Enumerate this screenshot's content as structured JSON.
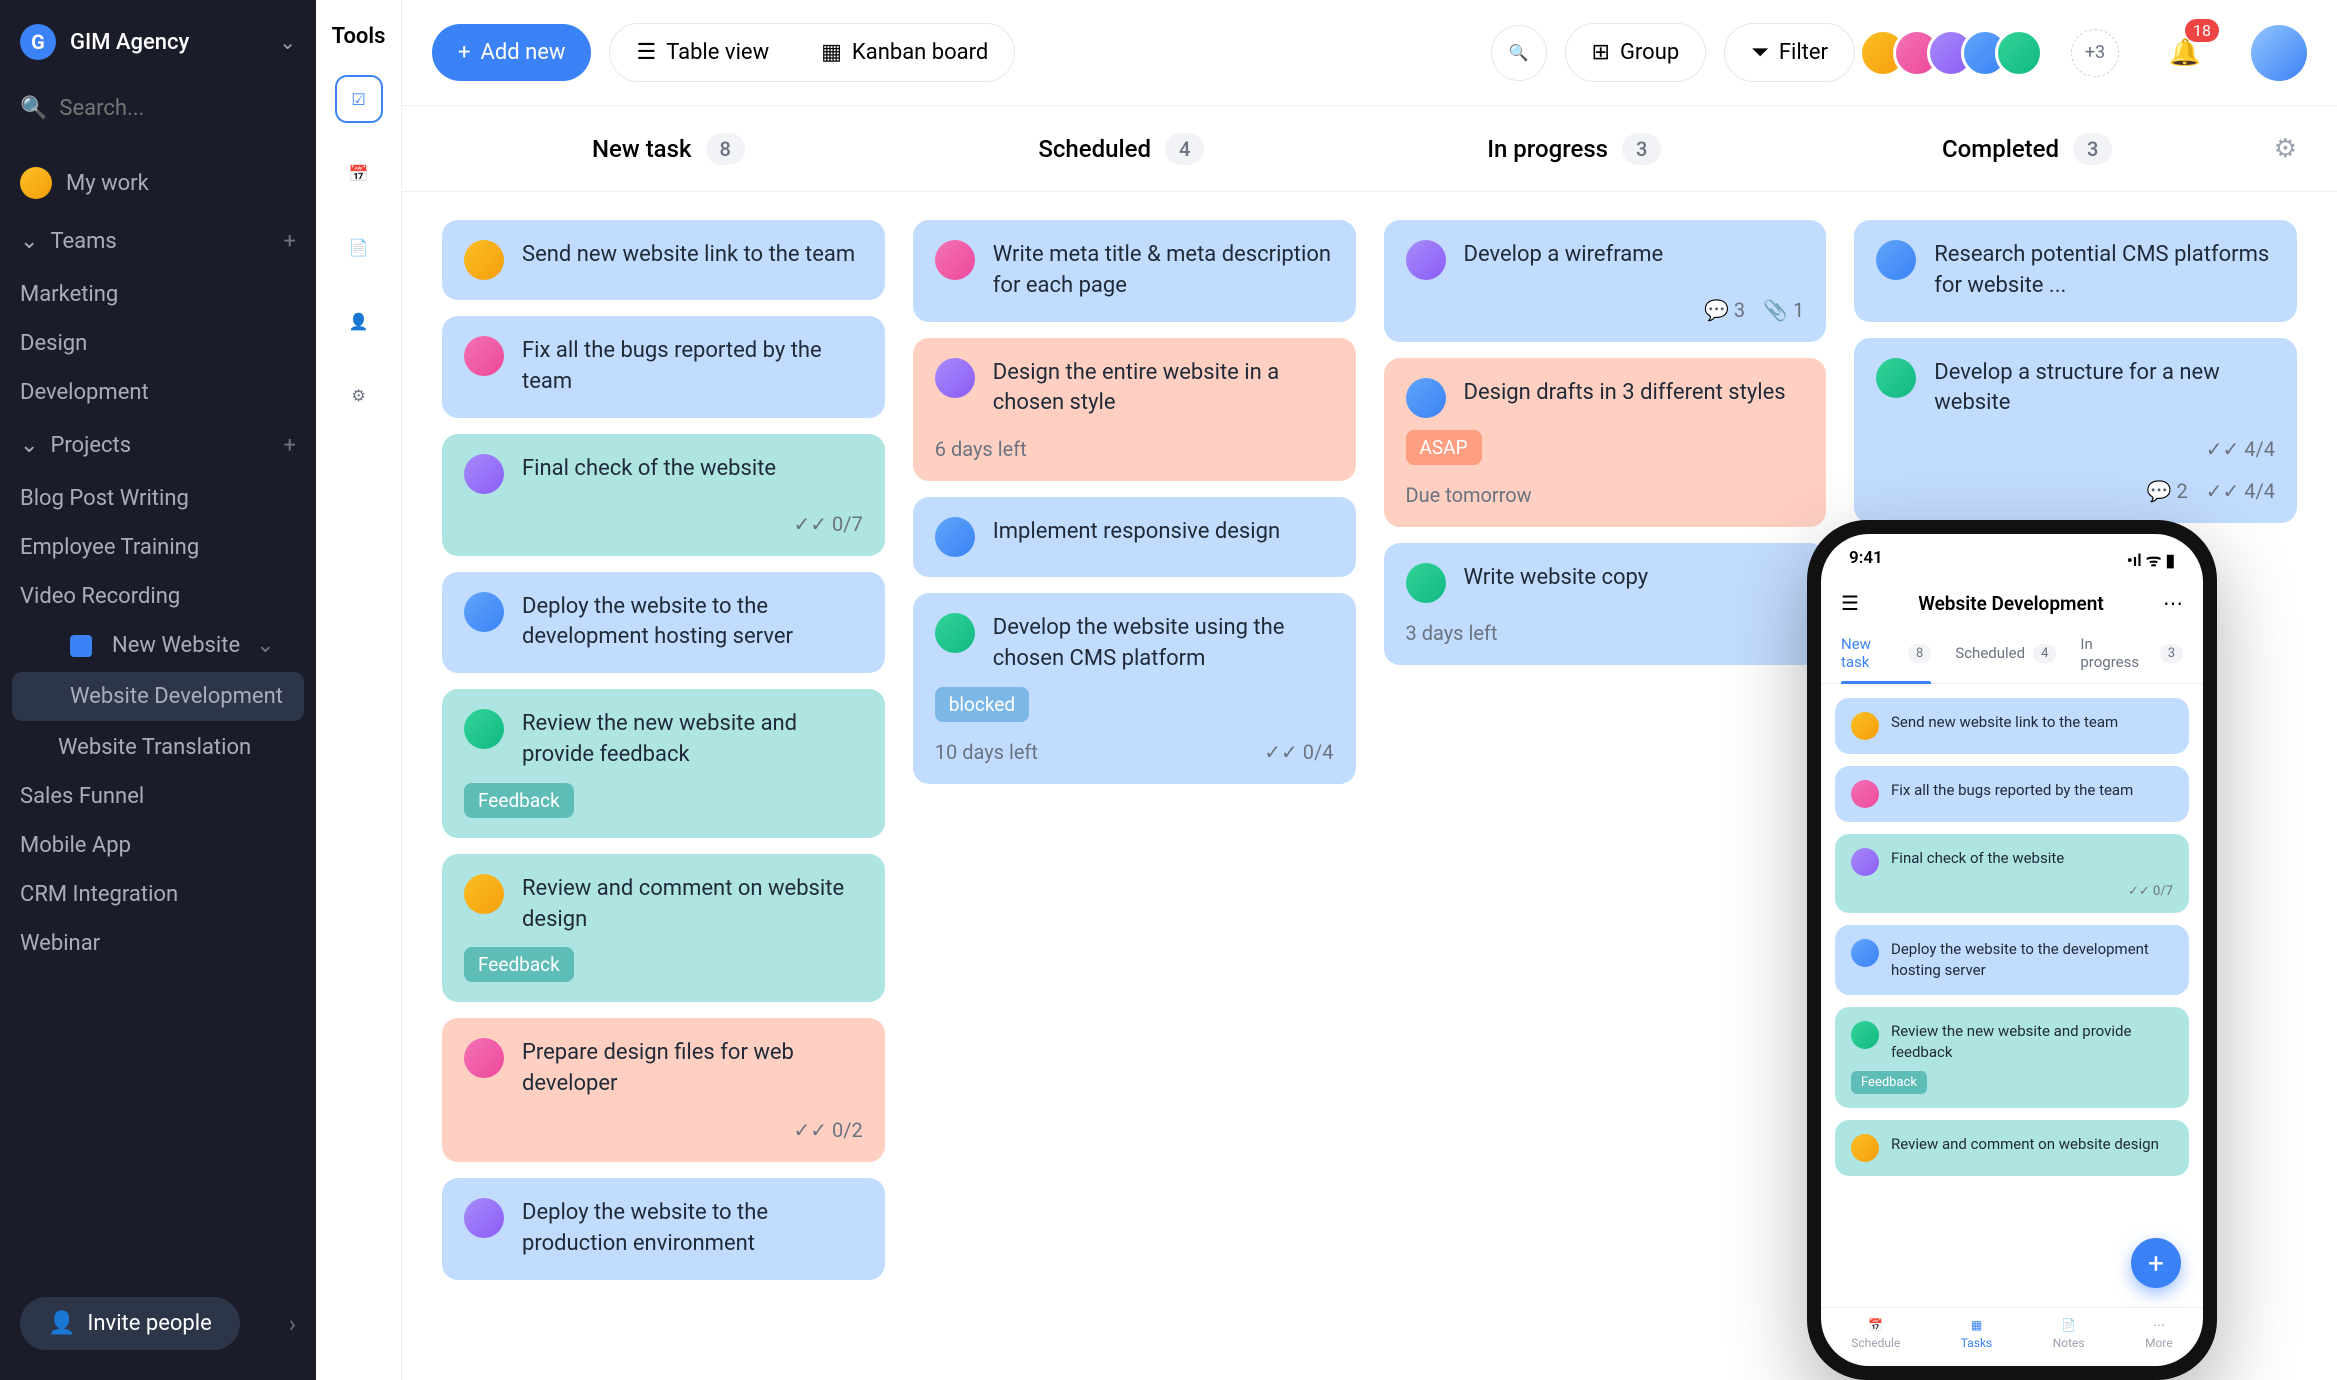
{
  "workspace": {
    "name": "GIM Agency",
    "initial": "G"
  },
  "search_placeholder": "Search...",
  "my_work_label": "My work",
  "sections": {
    "teams": {
      "label": "Teams",
      "items": [
        "Marketing",
        "Design",
        "Development"
      ]
    },
    "projects": {
      "label": "Projects",
      "items": [
        "Blog Post Writing",
        "Employee Training",
        "Video Recording",
        "New Website",
        "Sales Funnel",
        "Mobile App",
        "CRM Integration",
        "Webinar"
      ],
      "subitems": [
        "Website Development",
        "Website Translation"
      ]
    }
  },
  "invite_label": "Invite people",
  "tools_label": "Tools",
  "topbar": {
    "add_new": "Add new",
    "table_view": "Table view",
    "kanban": "Kanban board",
    "group": "Group",
    "filter": "Filter",
    "plus_count": "+3",
    "notifications": "18"
  },
  "columns": [
    {
      "name": "New task",
      "count": "8"
    },
    {
      "name": "Scheduled",
      "count": "4"
    },
    {
      "name": "In progress",
      "count": "3"
    },
    {
      "name": "Completed",
      "count": "3"
    }
  ],
  "cards": {
    "c0": [
      {
        "title": "Send new website link to the team",
        "color": "c-blue"
      },
      {
        "title": "Fix all the bugs reported by the team",
        "color": "c-blue"
      },
      {
        "title": "Final check of the website",
        "color": "c-teal",
        "checklist": "0/7"
      },
      {
        "title": "Deploy the website to the development hosting server",
        "color": "c-blue"
      },
      {
        "title": "Review the new website and provide feedback",
        "color": "c-teal",
        "tag": "Feedback",
        "tagClass": "tag-feedback"
      },
      {
        "title": "Review and comment on website design",
        "color": "c-teal",
        "tag": "Feedback",
        "tagClass": "tag-feedback"
      },
      {
        "title": "Prepare design files for web developer",
        "color": "c-orange",
        "checklist": "0/2"
      },
      {
        "title": "Deploy the website to the production environment",
        "color": "c-blue"
      }
    ],
    "c1": [
      {
        "title": "Write meta title & meta description for each page",
        "color": "c-blue"
      },
      {
        "title": "Design the entire website in a chosen style",
        "color": "c-orange",
        "due": "6 days left"
      },
      {
        "title": "Implement responsive design",
        "color": "c-blue"
      },
      {
        "title": "Develop the website using the chosen CMS platform",
        "color": "c-blue",
        "tag": "blocked",
        "tagClass": "tag-blocked",
        "due": "10 days left",
        "checklist": "0/4"
      }
    ],
    "c2": [
      {
        "title": "Develop a wireframe",
        "color": "c-blue",
        "comments": "3",
        "attachments": "1"
      },
      {
        "title": "Design drafts in 3 different styles",
        "color": "c-orange",
        "tag": "ASAP",
        "tagClass": "tag-asap",
        "due": "Due tomorrow"
      },
      {
        "title": "Write website copy",
        "color": "c-blue",
        "due": "3 days left"
      }
    ],
    "c3": [
      {
        "title": "Research potential CMS platforms for website ...",
        "color": "c-blue"
      },
      {
        "title": "Develop a structure for a new website",
        "color": "c-blue",
        "comments": "2",
        "checklist": "4/4"
      },
      {
        "title": "",
        "color": "c-blue",
        "partial": true
      }
    ]
  },
  "phone": {
    "time": "9:41",
    "title": "Website Development",
    "tabs": [
      {
        "label": "New task",
        "count": "8"
      },
      {
        "label": "Scheduled",
        "count": "4"
      },
      {
        "label": "In progress",
        "count": "3"
      }
    ],
    "cards": [
      {
        "title": "Send new website link to the team",
        "color": "c-blue"
      },
      {
        "title": "Fix all the bugs reported by the team",
        "color": "c-blue"
      },
      {
        "title": "Final check of the website",
        "color": "c-teal",
        "checklist": "0/7"
      },
      {
        "title": "Deploy the website to the development hosting server",
        "color": "c-blue"
      },
      {
        "title": "Review the new website and provide feedback",
        "color": "c-teal",
        "tag": "Feedback",
        "tagClass": "tag-feedback"
      },
      {
        "title": "Review and comment on website design",
        "color": "c-teal"
      }
    ],
    "nav": [
      "Schedule",
      "Tasks",
      "Notes",
      "More"
    ]
  }
}
